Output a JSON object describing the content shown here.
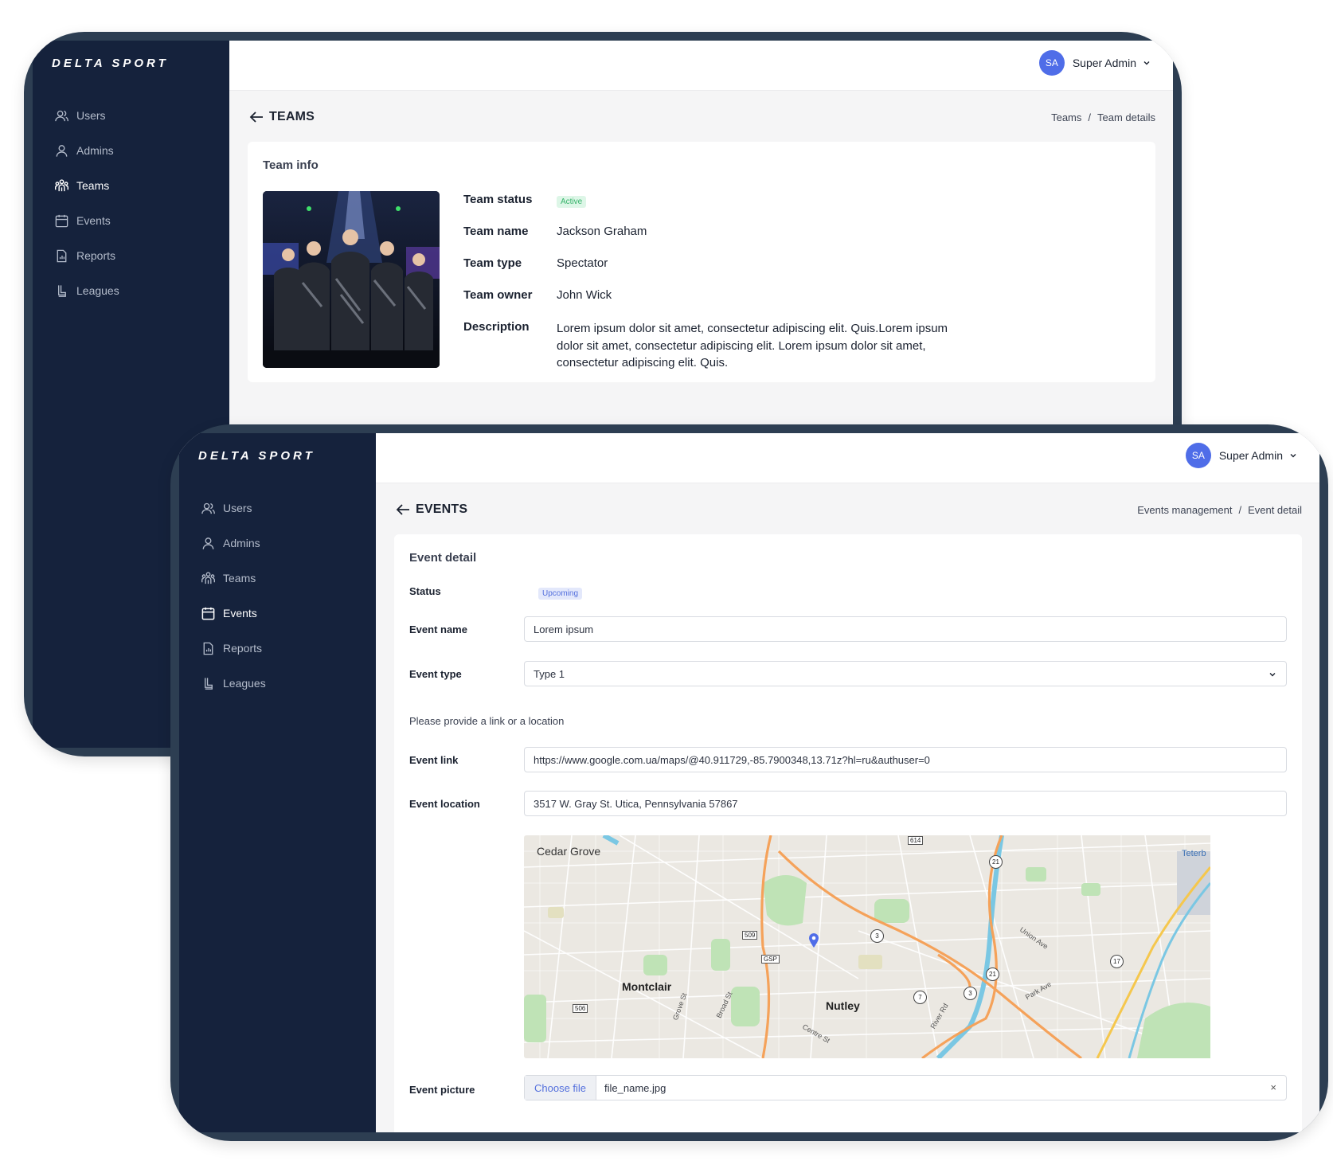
{
  "brand": {
    "logo_text": "DELTA SPORT"
  },
  "user": {
    "initials": "SA",
    "name": "Super Admin"
  },
  "sidebar": {
    "items": [
      {
        "label": "Users",
        "icon": "users-icon"
      },
      {
        "label": "Admins",
        "icon": "user-icon"
      },
      {
        "label": "Teams",
        "icon": "team-icon"
      },
      {
        "label": "Events",
        "icon": "calendar-icon"
      },
      {
        "label": "Reports",
        "icon": "report-icon"
      },
      {
        "label": "Leagues",
        "icon": "league-icon"
      }
    ]
  },
  "teams_screen": {
    "active_nav": "Teams",
    "page_title": "TEAMS",
    "breadcrumb": [
      "Teams",
      "Team details"
    ],
    "card_title": "Team info",
    "status_label": "Team status",
    "status_value": "Active",
    "name_label": "Team name",
    "name_value": "Jackson Graham",
    "type_label": "Team type",
    "type_value": "Spectator",
    "owner_label": "Team owner",
    "owner_value": "John Wick",
    "description_label": "Description",
    "description_lines": [
      "Lorem ipsum dolor sit amet, consectetur adipiscing elit. Quis.Lorem ipsum",
      "dolor sit amet, consectetur adipiscing elit. Lorem ipsum dolor sit amet,",
      "consectetur adipiscing elit. Quis."
    ]
  },
  "events_screen": {
    "active_nav": "Events",
    "page_title": "EVENTS",
    "breadcrumb": [
      "Events management",
      "Event detail"
    ],
    "card_title": "Event detail",
    "status_label": "Status",
    "status_value": "Upcoming",
    "name_label": "Event name",
    "name_value": "Lorem ipsum",
    "type_label": "Event type",
    "type_value": "Type 1",
    "hint": "Please provide a link or a location",
    "link_label": "Event link",
    "link_value": "https://www.google.com.ua/maps/@40.911729,-85.7900348,13.71z?hl=ru&authuser=0",
    "location_label": "Event location",
    "location_value": "3517 W. Gray St. Utica, Pennsylvania 57867",
    "picture_label": "Event picture",
    "file_button": "Choose file",
    "file_name": "file_name.jpg",
    "map": {
      "places": [
        "Cedar Grove",
        "Montclair",
        "Nutley",
        "Teterb"
      ],
      "streets": [
        "Grove St",
        "Broad St",
        "Centre St",
        "River Rd",
        "Union Ave",
        "Park Ave"
      ],
      "route_shields": [
        "614",
        "509",
        "GSP",
        "506",
        "21",
        "3",
        "21",
        "3",
        "7",
        "17"
      ]
    }
  },
  "colors": {
    "sidebar": "#15223c",
    "frame": "#2d3e52",
    "accent": "#4f6de8",
    "active_badge": "#36b36a",
    "upcoming_badge": "#5470dd"
  }
}
